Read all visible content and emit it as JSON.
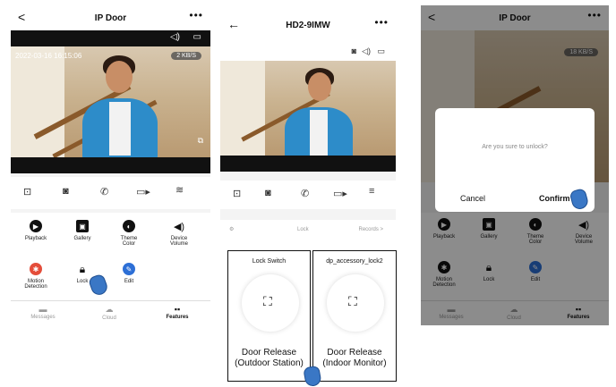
{
  "screen1": {
    "title": "IP Door",
    "back": "<",
    "more": "•••",
    "timestamp": "2022-03-16  16:15:06",
    "speed": "2 KB/S",
    "controls": [
      "screenshot-icon",
      "camera-icon",
      "call-icon",
      "video-icon",
      "more-icon"
    ],
    "features": [
      {
        "label": "Playback",
        "color": "#111"
      },
      {
        "label": "Gallery",
        "color": "#111"
      },
      {
        "label": "Theme\nColor",
        "color": "#111"
      },
      {
        "label": "Device\nVolume",
        "color": "#111"
      },
      {
        "label": "Motion\nDetection",
        "color": "#e44d3a"
      },
      {
        "label": "Lock",
        "color": "#111"
      },
      {
        "label": "Edit",
        "color": "#2d6fd6"
      }
    ],
    "tabs": [
      "Messages",
      "Cloud",
      "Features"
    ]
  },
  "screen2": {
    "title": "HD2-9IMW",
    "back": "←",
    "more": "•••",
    "lock_label": "Lock",
    "records_label": "Records >",
    "card1_title": "Lock Switch",
    "card1_caption": "Door Release\n(Outdoor Station)",
    "card2_title": "dp_accessory_lock2",
    "card2_caption": "Door Release\n(Indoor Monitor)"
  },
  "screen3": {
    "title": "IP Door",
    "speed": "18 KB/S",
    "dialog_text": "Are you sure to unlock?",
    "cancel": "Cancel",
    "confirm": "Confirm",
    "features": [
      "Playback",
      "Gallery",
      "Theme\nColor",
      "Device\nVolume",
      "Motion\nDetection",
      "Lock",
      "Edit"
    ],
    "tabs": [
      "Messages",
      "Cloud",
      "Features"
    ]
  },
  "colors": {
    "accent": "#2d6fd6",
    "danger": "#e44d3a"
  }
}
